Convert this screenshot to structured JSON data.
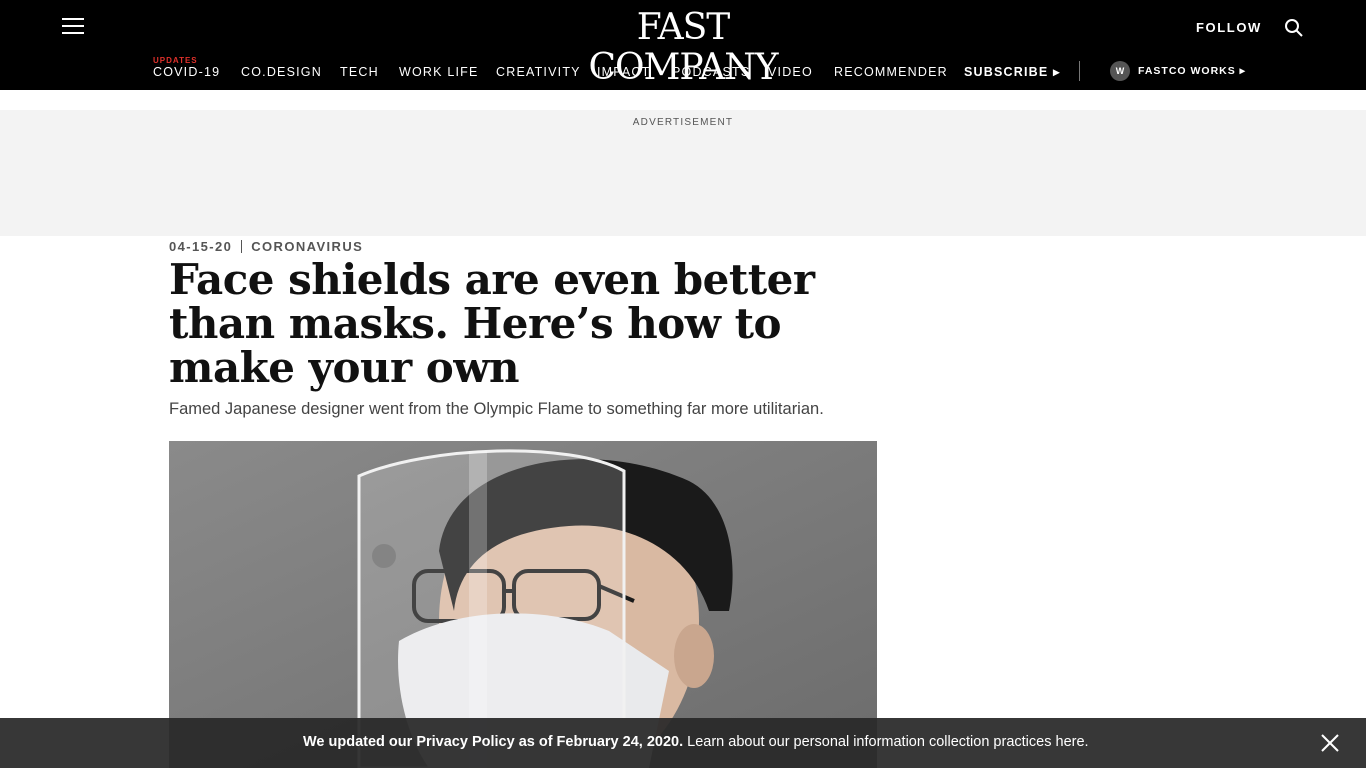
{
  "header": {
    "logo_text": "FAST COMPANY",
    "follow_label": "FOLLOW"
  },
  "nav": {
    "tag": "UPDATES",
    "items": [
      {
        "label": "COVID-19"
      },
      {
        "label": "CO.DESIGN"
      },
      {
        "label": "TECH"
      },
      {
        "label": "WORK LIFE"
      },
      {
        "label": "CREATIVITY"
      },
      {
        "label": "IMPACT"
      },
      {
        "label": "PODCASTS"
      },
      {
        "label": "VIDEO"
      },
      {
        "label": "RECOMMENDER"
      },
      {
        "label": "SUBSCRIBE ▸"
      }
    ],
    "fastco_badge": "W",
    "fastco_label": "FASTCO WORKS ▸"
  },
  "ad": {
    "label": "ADVERTISEMENT"
  },
  "article": {
    "date": "04-15-20",
    "category": "CORONAVIRUS",
    "headline": "Face shields are even better than masks. Here’s how to make your own",
    "dek": "Famed Japanese designer went from the Olympic Flame to something far more utilitarian."
  },
  "cookie_bar": {
    "bold_text": "We updated our Privacy Policy as of February 24, 2020.",
    "text": " Learn about our personal information collection practices ",
    "link": "here."
  },
  "colors": {
    "header_bg": "#000000",
    "accent_red": "#e0312b",
    "ad_bg": "#f3f3f3",
    "cookie_bg": "#282828"
  },
  "icons": [
    "hamburger-menu-icon",
    "search-icon",
    "close-icon"
  ]
}
